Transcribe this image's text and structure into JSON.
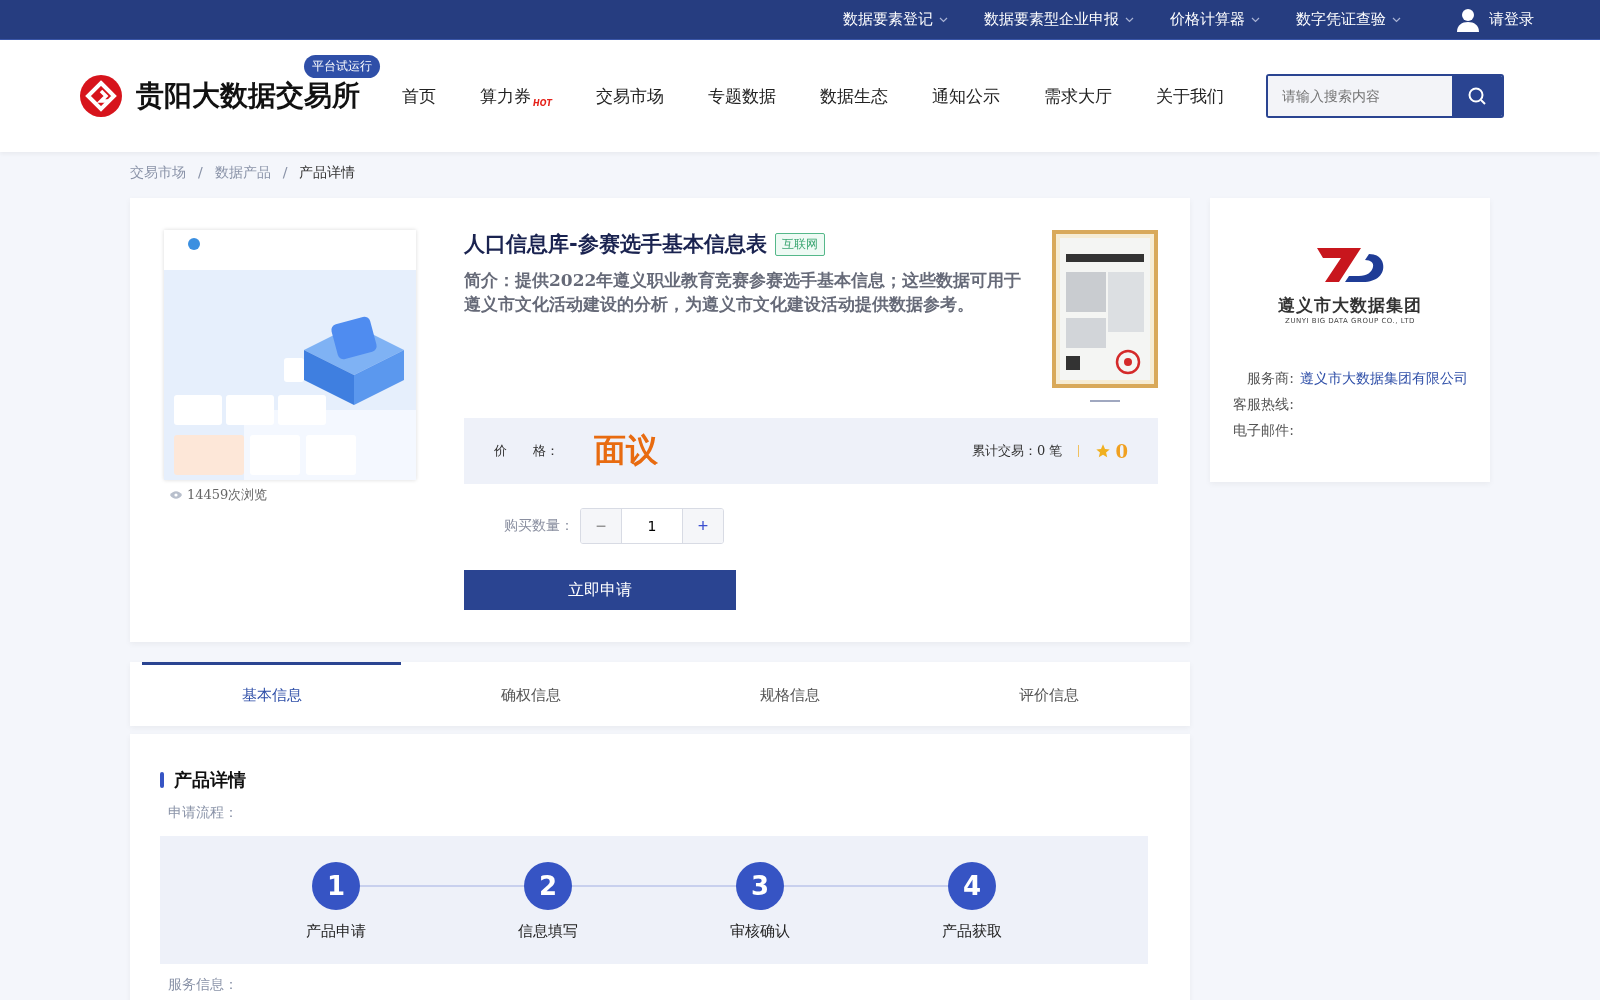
{
  "top_bar": {
    "links": [
      {
        "label": "数据要素登记"
      },
      {
        "label": "数据要素型企业申报"
      },
      {
        "label": "价格计算器"
      },
      {
        "label": "数字凭证查验"
      }
    ],
    "login": "请登录"
  },
  "header": {
    "site_name": "贵阳大数据交易所",
    "badge": "平台试运行",
    "nav": [
      {
        "label": "首页",
        "hot": false
      },
      {
        "label": "算力券",
        "hot": true,
        "hot_label": "HOT"
      },
      {
        "label": "交易市场",
        "hot": false
      },
      {
        "label": "专题数据",
        "hot": false
      },
      {
        "label": "数据生态",
        "hot": false
      },
      {
        "label": "通知公示",
        "hot": false
      },
      {
        "label": "需求大厅",
        "hot": false
      },
      {
        "label": "关于我们",
        "hot": false
      }
    ],
    "search": {
      "placeholder": "请输入搜索内容"
    }
  },
  "breadcrumb": {
    "separator": "/",
    "items": [
      {
        "label": "交易市场",
        "current": false
      },
      {
        "label": "数据产品",
        "current": false
      },
      {
        "label": "产品详情",
        "current": true
      }
    ]
  },
  "product": {
    "views": "14459次浏览",
    "title": "人口信息库-参赛选手基本信息表",
    "tag": "互联网",
    "intro": "简介：提供2022年遵义职业教育竞赛参赛选手基本信息；这些数据可用于遵义市文化活动建设的分析，为遵义市文化建设活动提供数据参考。",
    "price_label": "价　　格：",
    "price": "面议",
    "trades": "累计交易：0 笔",
    "rating": "0",
    "quantity_label": "购买数量：",
    "quantity": "1",
    "minus": "−",
    "plus": "+",
    "apply": "立即申请"
  },
  "provider": {
    "logo_name": "遵义市大数据集团",
    "logo_en": "ZUNYI BIG DATA GROUP CO., LTD",
    "fields": [
      {
        "label": "服务商:",
        "value": "遵义市大数据集团有限公司"
      },
      {
        "label": "客服热线:"
      },
      {
        "label": "电子邮件:"
      }
    ]
  },
  "tabs": [
    {
      "label": "基本信息",
      "selected": true
    },
    {
      "label": "确权信息",
      "selected": false
    },
    {
      "label": "规格信息",
      "selected": false
    },
    {
      "label": "评价信息",
      "selected": false
    }
  ],
  "details": {
    "heading": "产品详情",
    "process_label": "申请流程：",
    "steps": [
      {
        "number": "1",
        "label": "产品申请"
      },
      {
        "number": "2",
        "label": "信息填写"
      },
      {
        "number": "3",
        "label": "审核确认"
      },
      {
        "number": "4",
        "label": "产品获取"
      }
    ],
    "service_label": "服务信息："
  }
}
